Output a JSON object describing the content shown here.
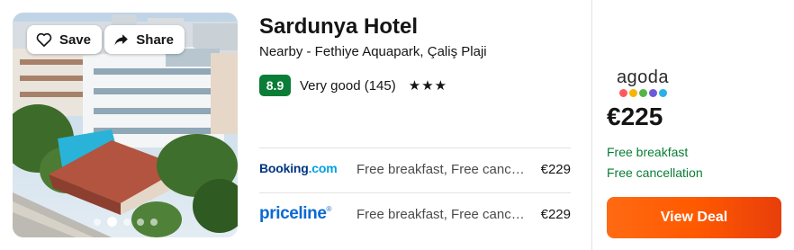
{
  "hotel": {
    "name": "Sardunya Hotel",
    "nearby": "Nearby - Fethiye Aquapark, Çaliş Plaji",
    "score": "8.9",
    "rating_text": "Very good (145)",
    "stars": "★★★"
  },
  "photo": {
    "save_label": "Save",
    "share_label": "Share",
    "carousel_count": 5,
    "carousel_active_index": 1
  },
  "providers": [
    {
      "name": "Booking.com",
      "name_main": "Booking",
      "name_suffix": ".com",
      "description": "Free breakfast, Free cancellation",
      "price": "€229"
    },
    {
      "name": "priceline",
      "name_main": "priceline",
      "name_suffix": "®",
      "description": "Free breakfast, Free cancellation",
      "price": "€229"
    }
  ],
  "deal": {
    "provider": "agoda",
    "price": "€225",
    "perks": [
      "Free breakfast",
      "Free cancellation"
    ],
    "button_label": "View Deal"
  },
  "colors": {
    "score_badge": "#0a7d36",
    "perk_text": "#0a7d36",
    "deal_button": "#ff5a00",
    "booking_blue": "#003580",
    "priceline_blue": "#0a69d4",
    "agoda_dots": [
      "#ff5a5f",
      "#f7b500",
      "#55b647",
      "#6b5bd8",
      "#2ab0e4"
    ]
  },
  "icons": {
    "save": "heart-icon",
    "share": "share-arrow-icon",
    "stars": "star-icon"
  }
}
